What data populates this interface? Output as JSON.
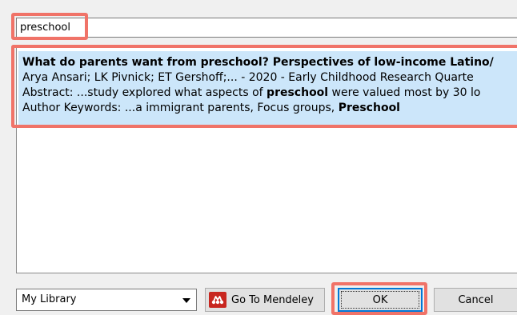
{
  "search": {
    "value": "preschool"
  },
  "results": [
    {
      "title": "What do parents want from preschool? Perspectives of low-income Latino/",
      "meta": "Arya Ansari; LK Pivnick; ET Gershoff;... - 2020 - Early Childhood Research Quarte",
      "abstract_prefix": "Abstract: ...study explored what aspects of ",
      "abstract_highlight": "preschool",
      "abstract_suffix": " were valued most by 30 lo",
      "keywords_prefix": "Author Keywords: ...a immigrant parents, Focus groups, ",
      "keywords_highlight": "Preschool"
    }
  ],
  "footer": {
    "library_selected": "My Library",
    "goto_label": "Go To Mendeley",
    "ok_label": "OK",
    "cancel_label": "Cancel"
  },
  "colors": {
    "highlight_annotation": "#f07368",
    "selection": "#cce6fa",
    "mendeley_brand": "#c8261f",
    "focus_border": "#0078d7"
  },
  "icons": {
    "goto_icon": "mendeley-logo-icon",
    "dropdown_icon": "chevron-down-icon"
  }
}
